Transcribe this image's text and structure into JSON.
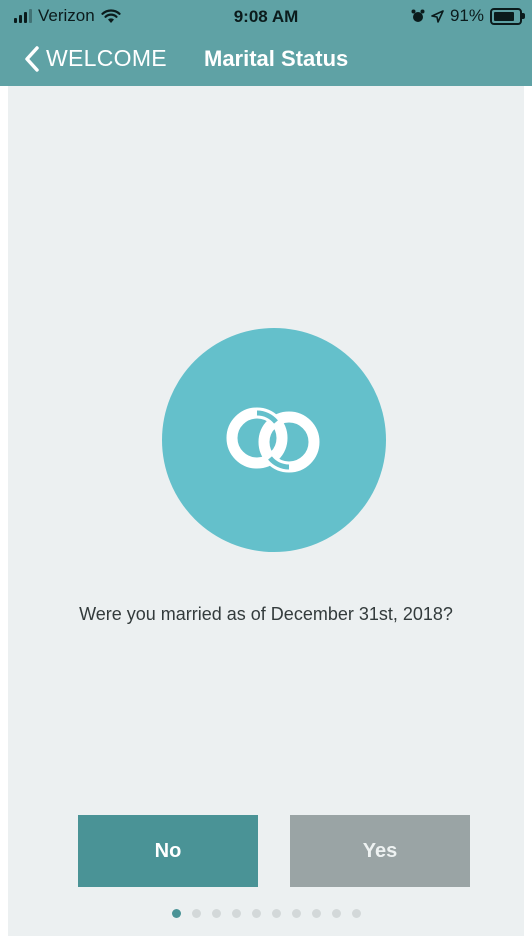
{
  "status_bar": {
    "carrier": "Verizon",
    "time": "9:08 AM",
    "battery": "91%",
    "battery_level": 0.91,
    "icons": [
      "signal-icon",
      "wifi-icon",
      "alarm-icon",
      "location-arrow-icon",
      "battery-icon"
    ]
  },
  "nav": {
    "back_label": "WELCOME",
    "title": "Marital Status"
  },
  "main": {
    "icon": "rings-icon",
    "question": "Were you married as of December 31st, 2018?"
  },
  "buttons": {
    "no_label": "No",
    "yes_label": "Yes"
  },
  "pagination": {
    "total": 10,
    "current": 1
  },
  "colors": {
    "header": "#5fa2a5",
    "emblem": "#64c0cb",
    "no_button": "#4a9396",
    "yes_button": "#9aa4a5",
    "background": "#ecf0f1"
  }
}
